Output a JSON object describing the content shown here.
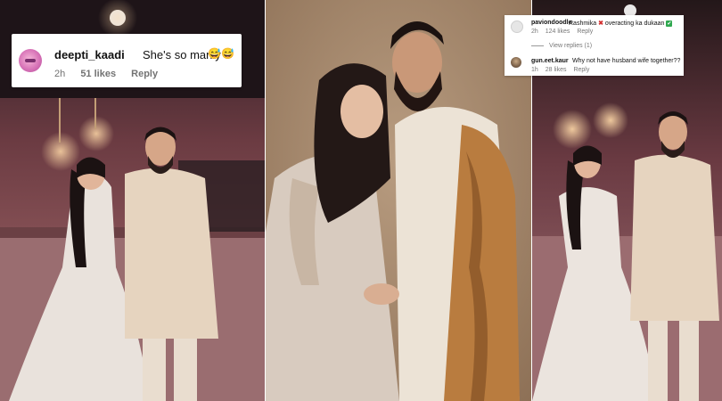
{
  "collage": {
    "left_photo": {
      "subject": "couple-on-runway-left",
      "colors": {
        "backdrop": "#7a4a4e",
        "floor": "#9b6a6c",
        "dress": "#ece6e0",
        "sherwani": "#e8d8c4"
      }
    },
    "center_photo": {
      "subject": "couple-portrait",
      "colors": {
        "backdrop": "#a88d72",
        "saree": "#d9cbbd",
        "shawl": "#b57a3c"
      }
    },
    "right_photo": {
      "subject": "couple-on-runway-right",
      "colors": {
        "backdrop": "#6e3f46",
        "dress": "#ece6e0",
        "sherwani": "#e8d8c4"
      }
    }
  },
  "comment_left": {
    "username": "deepti_kaadi",
    "text": "She's so manly",
    "emoji": "😅😅",
    "time": "2h",
    "likes": "51 likes",
    "reply": "Reply"
  },
  "comment_right": {
    "first": {
      "username": "paviondoodle",
      "text_before": "Rashmika",
      "text_after": "overacting ka dukaan",
      "time": "2h",
      "likes": "124 likes",
      "reply": "Reply",
      "view_replies": "View replies (1)"
    },
    "second": {
      "username": "gun.eet.kaur",
      "text": "Why not have husband wife together??",
      "time": "1h",
      "likes": "28 likes",
      "reply": "Reply"
    }
  }
}
